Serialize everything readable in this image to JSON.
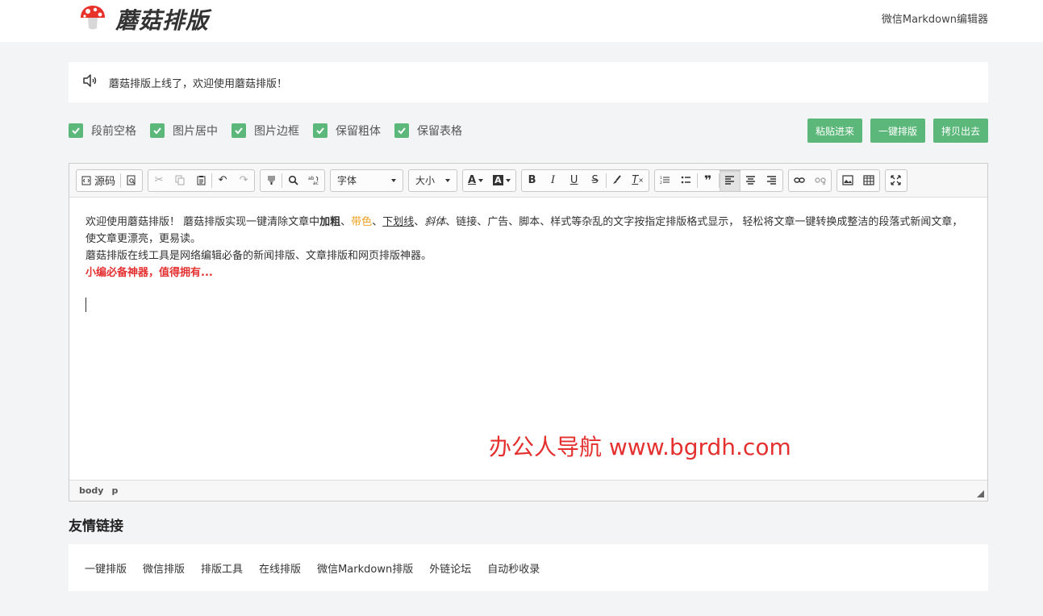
{
  "header": {
    "logo_text": "蘑菇排版",
    "right_link": "微信Markdown编辑器"
  },
  "notice": {
    "text": "蘑菇排版上线了，欢迎使用蘑菇排版！"
  },
  "options": [
    {
      "label": "段前空格",
      "checked": true
    },
    {
      "label": "图片居中",
      "checked": true
    },
    {
      "label": "图片边框",
      "checked": true
    },
    {
      "label": "保留粗体",
      "checked": true
    },
    {
      "label": "保留表格",
      "checked": true
    }
  ],
  "actions": {
    "paste": "粘贴进来",
    "format": "一键排版",
    "copy": "拷贝出去"
  },
  "toolbar": {
    "source_label": "源码",
    "font_select": "字体",
    "size_select": "大小"
  },
  "content": {
    "p1_a": "欢迎使用蘑菇排版！ 蘑菇排版实现一键清除文章中",
    "p1_bold": "加粗",
    "p1_sep1": "、",
    "p1_color": "带色",
    "p1_sep2": "、",
    "p1_underline": "下划线",
    "p1_sep3": "、",
    "p1_italic": "斜体",
    "p1_b": "、链接、广告、脚本、样式等杂乱的文字按指定排版格式显示， 轻松将文章一键转换成整洁的段落式新闻文章，使文章更漂亮，更易读。",
    "p2": "蘑菇排版在线工具是网络编辑必备的新闻排版、文章排版和网页排版神器。",
    "p3": "小编必备神器，值得拥有..."
  },
  "watermark": "办公人导航 www.bgrdh.com",
  "statusbar": {
    "path1": "body",
    "path2": "p"
  },
  "friends": {
    "title": "友情链接",
    "links": [
      "一键排版",
      "微信排版",
      "排版工具",
      "在线排版",
      "微信Markdown排版",
      "外链论坛",
      "自动秒收录"
    ]
  },
  "colors": {
    "accent": "#5cb87a",
    "highlight_orange": "#f0a020",
    "highlight_red": "#e53030"
  }
}
